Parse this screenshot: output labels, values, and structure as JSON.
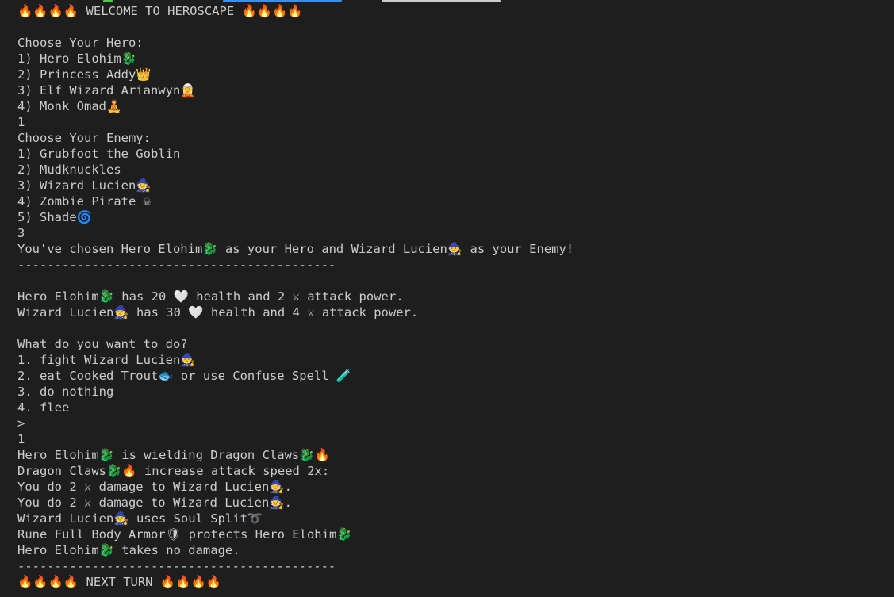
{
  "terminal": {
    "background": "#1e1e1e",
    "foreground": "#cccccc",
    "prompt_line": ">",
    "lines": [
      "🔥🔥🔥🔥 WELCOME TO HEROSCAPE 🔥🔥🔥🔥",
      "",
      "Choose Your Hero:",
      "1) Hero Elohim🐉",
      "2) Princess Addy👑",
      "3) Elf Wizard Arianwyn🧝",
      "4) Monk Omad🧘",
      "1",
      "Choose Your Enemy:",
      "1) Grubfoot the Goblin",
      "2) Mudknuckles",
      "3) Wizard Lucien🧙",
      "4) Zombie Pirate ☠",
      "5) Shade🌀",
      "3",
      "You've chosen Hero Elohim🐉 as your Hero and Wizard Lucien🧙 as your Enemy!",
      "-------------------------------------------",
      "",
      "Hero Elohim🐉 has 20 🤍 health and 2 ⚔ attack power.",
      "Wizard Lucien🧙 has 30 🤍 health and 4 ⚔ attack power.",
      "",
      "What do you want to do?",
      "1. fight Wizard Lucien🧙",
      "2. eat Cooked Trout🐟 or use Confuse Spell 🧪",
      "3. do nothing",
      "4. flee",
      ">",
      "1",
      "Hero Elohim🐉 is wielding Dragon Claws🐉🔥",
      "Dragon Claws🐉🔥 increase attack speed 2x:",
      "You do 2 ⚔ damage to Wizard Lucien🧙.",
      "You do 2 ⚔ damage to Wizard Lucien🧙.",
      "Wizard Lucien🧙 uses Soul Split➰",
      "Rune Full Body Armor🛡 protects Hero Elohim🐉",
      "Hero Elohim🐉 takes no damage.",
      "-------------------------------------------",
      "🔥🔥🔥🔥 NEXT TURN 🔥🔥🔥🔥"
    ]
  }
}
